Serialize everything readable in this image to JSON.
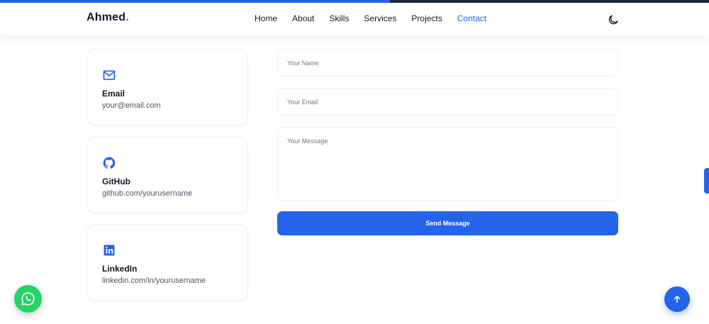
{
  "brand": {
    "name": "Ahmed",
    "dot": ".",
    "accent": "#2563eb"
  },
  "nav": {
    "items": [
      {
        "label": "Home"
      },
      {
        "label": "About"
      },
      {
        "label": "Skills"
      },
      {
        "label": "Services"
      },
      {
        "label": "Projects"
      },
      {
        "label": "Contact",
        "active": true
      }
    ],
    "theme_toggle_icon": "moon-icon"
  },
  "scroll_progress_percent": 55,
  "contact_cards": [
    {
      "icon": "mail-icon",
      "title": "Email",
      "value": "your@email.com"
    },
    {
      "icon": "github-icon",
      "title": "GitHub",
      "value": "github.com/yourusername"
    },
    {
      "icon": "linkedin-icon",
      "title": "LinkedIn",
      "value": "linkedin.com/in/yourusername"
    }
  ],
  "form": {
    "name_placeholder": "Your Name",
    "email_placeholder": "Your Email",
    "message_placeholder": "Your Message",
    "submit_label": "Send Message"
  },
  "floating": {
    "whatsapp_icon": "whatsapp-icon",
    "whatsapp_color": "#25d366",
    "back_to_top_icon": "arrow-up-icon"
  }
}
